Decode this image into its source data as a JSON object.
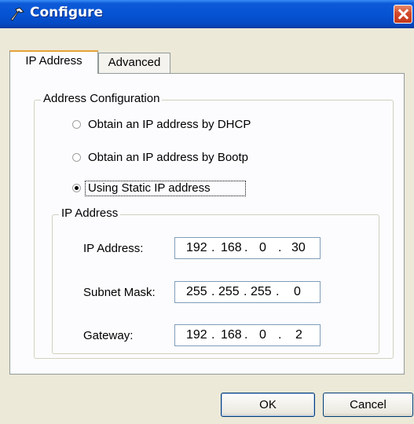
{
  "window": {
    "title": "Configure"
  },
  "tabs": [
    {
      "label": "IP Address",
      "active": true
    },
    {
      "label": "Advanced",
      "active": false
    }
  ],
  "address_configuration": {
    "group_label": "Address Configuration",
    "options": [
      {
        "label": "Obtain an IP address by DHCP",
        "checked": false
      },
      {
        "label": "Obtain an IP address by Bootp",
        "checked": false
      },
      {
        "label": "Using Static IP address",
        "checked": true
      }
    ]
  },
  "ip_group": {
    "group_label": "IP Address",
    "fields": [
      {
        "label": "IP Address:",
        "octets": [
          "192",
          "168",
          "0",
          "30"
        ]
      },
      {
        "label": "Subnet Mask:",
        "octets": [
          "255",
          "255",
          "255",
          "0"
        ]
      },
      {
        "label": "Gateway:",
        "octets": [
          "192",
          "168",
          "0",
          "2"
        ]
      }
    ]
  },
  "buttons": {
    "ok": "OK",
    "cancel": "Cancel"
  },
  "colors": {
    "titlebar": "#0654d3",
    "close": "#d2492a",
    "dialog_bg": "#ece9d8",
    "panel_bg": "#fcfcfe"
  }
}
